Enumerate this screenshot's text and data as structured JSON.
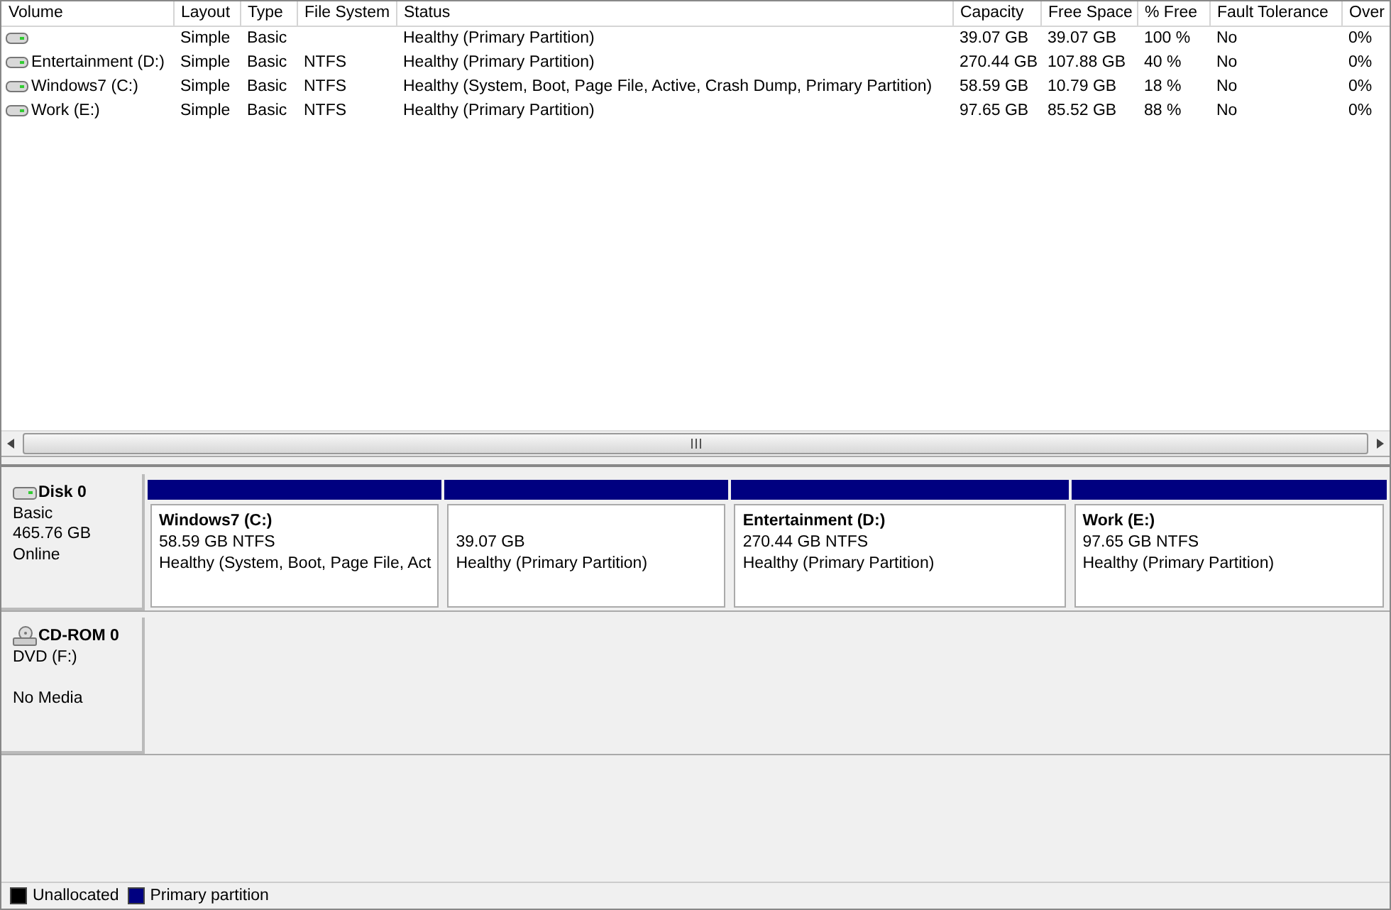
{
  "volume_list": {
    "columns": [
      "Volume",
      "Layout",
      "Type",
      "File System",
      "Status",
      "Capacity",
      "Free Space",
      "% Free",
      "Fault Tolerance",
      "Over"
    ],
    "rows": [
      {
        "cells": [
          "",
          "Simple",
          "Basic",
          "",
          "Healthy (Primary Partition)",
          "39.07 GB",
          "39.07 GB",
          "100 %",
          "No",
          "0%"
        ]
      },
      {
        "cells": [
          "Entertainment (D:)",
          "Simple",
          "Basic",
          "NTFS",
          "Healthy (Primary Partition)",
          "270.44 GB",
          "107.88 GB",
          "40 %",
          "No",
          "0%"
        ]
      },
      {
        "cells": [
          "Windows7 (C:)",
          "Simple",
          "Basic",
          "NTFS",
          "Healthy (System, Boot, Page File, Active, Crash Dump, Primary Partition)",
          "58.59 GB",
          "10.79 GB",
          "18 %",
          "No",
          "0%"
        ]
      },
      {
        "cells": [
          "Work (E:)",
          "Simple",
          "Basic",
          "NTFS",
          "Healthy (Primary Partition)",
          "97.65 GB",
          "85.52 GB",
          "88 %",
          "No",
          "0%"
        ]
      }
    ]
  },
  "disks": [
    {
      "kind": "disk",
      "name": "Disk 0",
      "lines": [
        "Basic",
        "465.76 GB",
        "Online"
      ],
      "partitions": [
        {
          "title": "Windows7  (C:)",
          "size": "58.59 GB NTFS",
          "status": "Healthy (System, Boot, Page File, Act",
          "color": "#000080"
        },
        {
          "size": "39.07 GB",
          "status": "Healthy (Primary Partition)",
          "color": "#000080"
        },
        {
          "title": "Entertainment  (D:)",
          "size": "270.44 GB NTFS",
          "status": "Healthy (Primary Partition)",
          "color": "#000080"
        },
        {
          "title": "Work  (E:)",
          "size": "97.65 GB NTFS",
          "status": "Healthy (Primary Partition)",
          "color": "#000080"
        }
      ]
    },
    {
      "kind": "cdrom",
      "name": "CD-ROM 0",
      "lines": [
        "DVD (F:)",
        "No Media"
      ]
    }
  ],
  "legend": [
    {
      "label": "Unallocated",
      "color": "#000000"
    },
    {
      "label": "Primary partition",
      "color": "#000080"
    }
  ]
}
